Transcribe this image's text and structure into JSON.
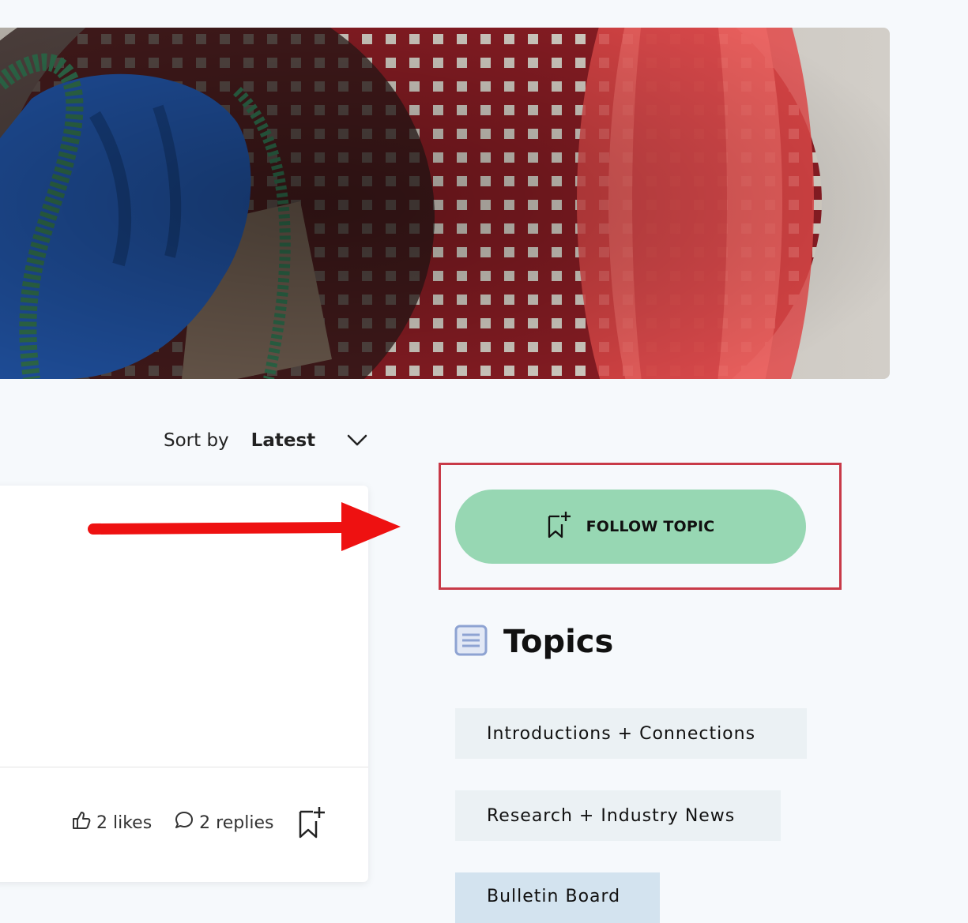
{
  "hero": {
    "description_icon": "hero-photo"
  },
  "sort": {
    "label": "Sort by",
    "value": "Latest",
    "icon": "chevron-down-icon"
  },
  "post": {
    "likes_label": "2 likes",
    "replies_label": "2 replies",
    "like_icon": "thumbs-up-icon",
    "reply_icon": "speech-bubble-icon",
    "bookmark_icon": "bookmark-add-icon"
  },
  "follow": {
    "label": "FOLLOW TOPIC",
    "icon": "bookmark-add-icon",
    "color": "#97d7b3",
    "highlight_color": "#c83a48"
  },
  "topics": {
    "title": "Topics",
    "icon": "document-list-icon",
    "items": [
      {
        "label": "Introductions + Connections"
      },
      {
        "label": "Research + Industry News"
      },
      {
        "label": "Bulletin Board"
      }
    ]
  },
  "annotation": {
    "arrow_color": "#ee1111"
  }
}
